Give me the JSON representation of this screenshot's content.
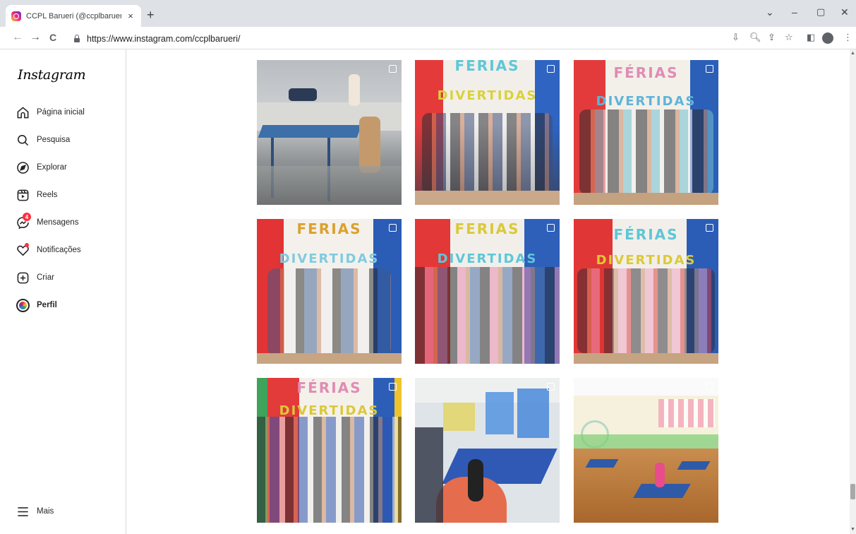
{
  "browser": {
    "tab_title": "CCPL Barueri (@ccplbarueri) • Fo",
    "tab_close": "×",
    "new_tab": "+",
    "url": "https://www.instagram.com/ccplbarueri/",
    "win_chevron": "⌄",
    "win_minimize": "–",
    "win_maximize": "▢",
    "win_close": "✕",
    "back": "←",
    "forward": "→",
    "reload": "C",
    "menu_dots": "⋮"
  },
  "sidebar": {
    "logo": "Instagram",
    "items": [
      {
        "label": "Página inicial",
        "icon": "home-icon"
      },
      {
        "label": "Pesquisa",
        "icon": "search-icon"
      },
      {
        "label": "Explorar",
        "icon": "compass-icon"
      },
      {
        "label": "Reels",
        "icon": "reels-icon"
      },
      {
        "label": "Mensagens",
        "icon": "messenger-icon",
        "badge": "4"
      },
      {
        "label": "Notificações",
        "icon": "heart-icon"
      },
      {
        "label": "Criar",
        "icon": "plus-square-icon"
      },
      {
        "label": "Perfil",
        "icon": "profile-avatar"
      }
    ],
    "more": "Mais"
  },
  "grid": {
    "posts": [
      {
        "banner": "",
        "scene": "ping-pong"
      },
      {
        "banner": "FERIAS DIVERTIDAS",
        "scene": "group"
      },
      {
        "banner": "FÉRIAS DIVERTIDAS",
        "scene": "group"
      },
      {
        "banner": "FERIAS DIVERTIDAS",
        "scene": "group"
      },
      {
        "banner": "FERIAS DIVERTIDAS",
        "scene": "group"
      },
      {
        "banner": "FÉRIAS DIVERTIDAS",
        "scene": "group"
      },
      {
        "banner": "FÉRIAS DIVERTIDAS",
        "scene": "group"
      },
      {
        "banner": "",
        "scene": "classroom"
      },
      {
        "banner": "",
        "scene": "gym"
      }
    ]
  }
}
